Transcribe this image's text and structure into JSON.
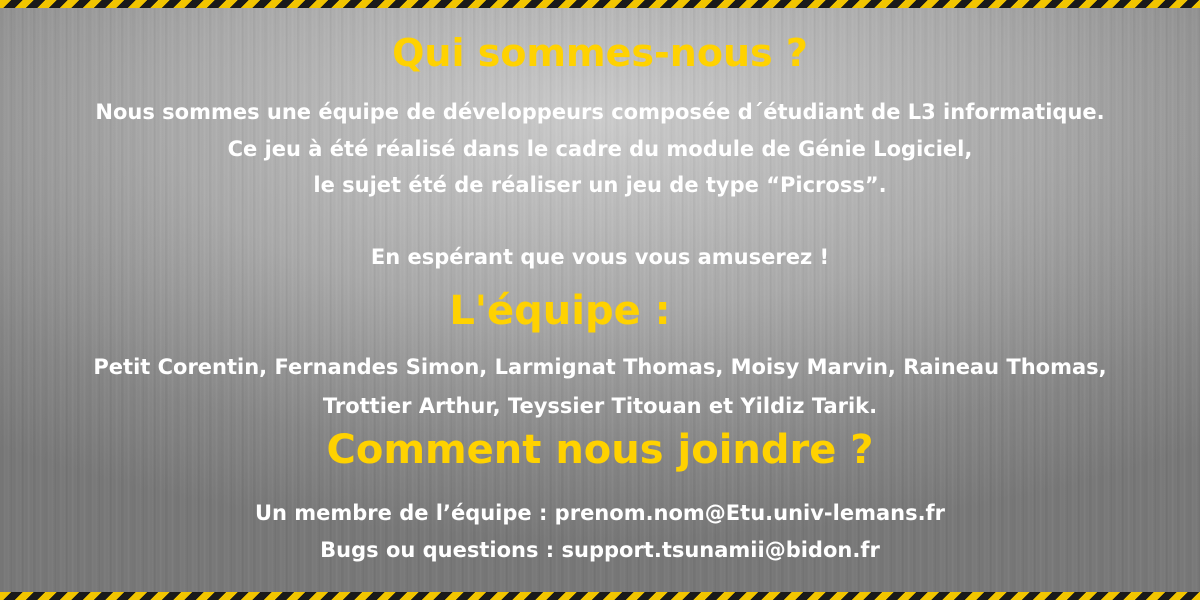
{
  "about": {
    "title": "Qui sommes-nous ?",
    "line1": "Nous sommes une équipe de développeurs composée d´étudiant de L3 informatique.",
    "line2": "Ce jeu à été réalisé dans le cadre du module de Génie Logiciel,",
    "line3": "le sujet été de réaliser un jeu de type “Picross”.",
    "line4": "En espérant que vous vous amuserez !"
  },
  "team": {
    "title": "L'équipe :",
    "line1": "Petit Corentin, Fernandes Simon, Larmignat Thomas, Moisy Marvin, Raineau Thomas,",
    "line2": "Trottier Arthur, Teyssier Titouan et Yildiz Tarik."
  },
  "contact": {
    "title": "Comment nous joindre ?",
    "member_line": "Un membre de l’équipe : prenom.nom@Etu.univ-lemans.fr",
    "bugs_line": "Bugs ou questions : support.tsunamii@bidon.fr"
  },
  "colors": {
    "heading": "#ffd200",
    "text": "#ffffff",
    "stripe_yellow": "#f2c500",
    "stripe_black": "#1a1a1a"
  }
}
